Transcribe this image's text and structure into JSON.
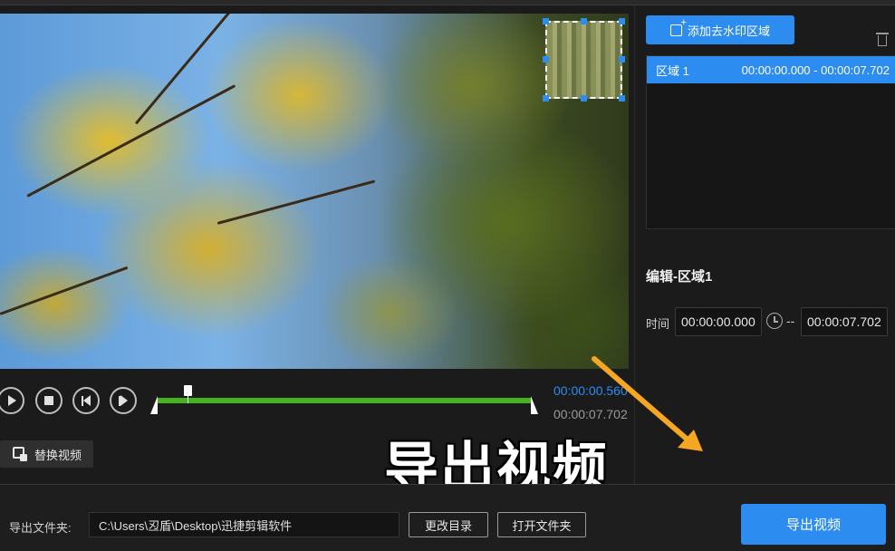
{
  "controls": {
    "current_time": "00:00:00.560",
    "total_time": "00:00:07.702",
    "playhead_progress": 0.08,
    "replace_video_label": "替换视频"
  },
  "overlay": {
    "caption": "导出视频",
    "arrow_color": "#f5a623"
  },
  "right_panel": {
    "add_region_label": "添加去水印区域",
    "regions": [
      {
        "name": "区域 1",
        "range": "00:00:00.000 - 00:00:07.702"
      }
    ],
    "edit_title": "编辑-区域1",
    "time_label": "时间",
    "start_time": "00:00:00.000",
    "separator": "--",
    "end_time": "00:00:07.702"
  },
  "bottom_bar": {
    "folder_label": "导出文件夹:",
    "path": "C:\\Users\\丒盾\\Desktop\\迅捷剪辑软件",
    "change_dir_label": "更改目录",
    "open_folder_label": "打开文件夹",
    "export_label": "导出视频"
  },
  "colors": {
    "accent": "#2d8cf0",
    "timeline_green": "#46b31e",
    "background": "#1b1b1b"
  },
  "icons": {
    "play": "play-icon",
    "stop": "stop-icon",
    "prev": "prev-frame-icon",
    "next": "next-frame-icon",
    "replace": "replace-video-icon",
    "add_region": "add-region-icon",
    "trash": "trash-icon",
    "clock": "clock-icon"
  }
}
